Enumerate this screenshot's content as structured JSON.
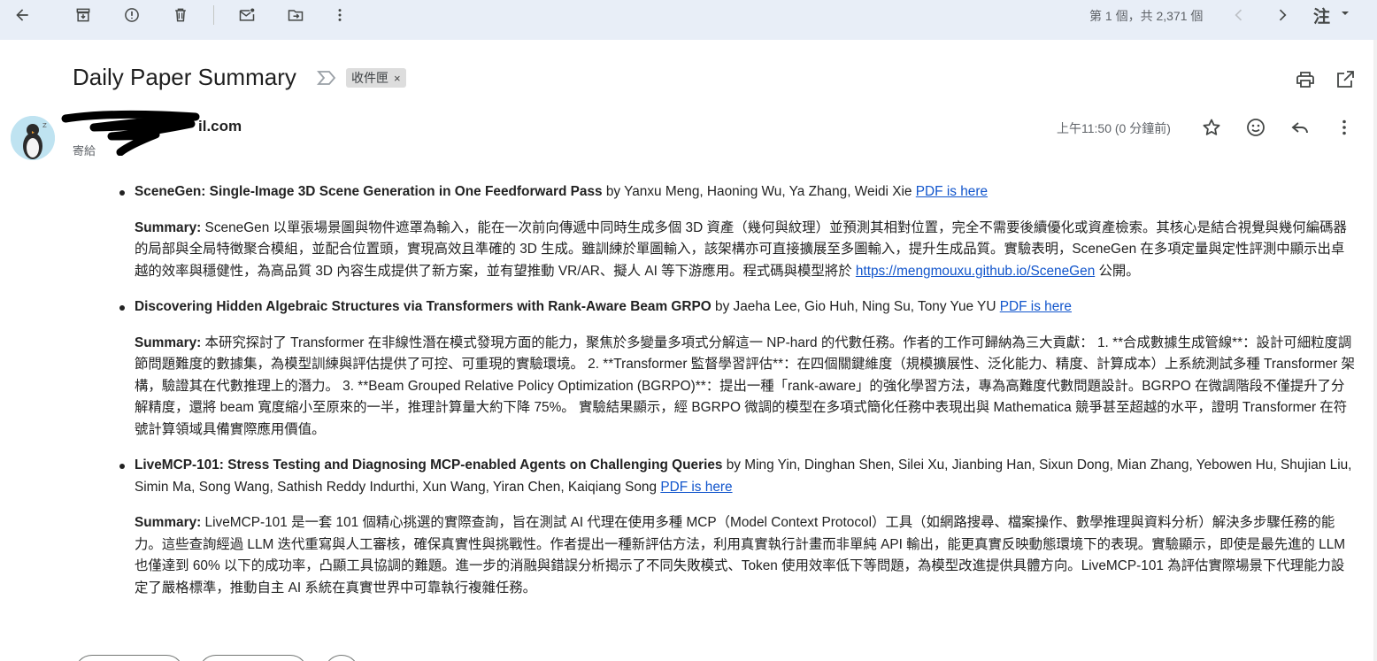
{
  "toolbar": {
    "icons": [
      "back-arrow-icon",
      "archive-icon",
      "report-spam-icon",
      "delete-icon",
      "mark-unread-icon",
      "move-to-icon",
      "more-vert-icon"
    ],
    "pager_text": "第 1 個，共 2,371 個",
    "input_tool_label": "注"
  },
  "message": {
    "subject": "Daily Paper Summary",
    "label": "收件匣",
    "sender_email": "il.com",
    "recipient_prefix": "寄給",
    "time": "上午11:50 (0 分鐘前)"
  },
  "papers": [
    {
      "title": "SceneGen: Single-Image 3D Scene Generation in One Feedforward Pass",
      "authors": " by Yanxu Meng, Haoning Wu, Ya Zhang, Weidi Xie ",
      "pdf_label": "PDF is here",
      "summary_label": "Summary:",
      "summary_text": " SceneGen 以單張場景圖與物件遮罩為輸入，能在一次前向傳遞中同時生成多個 3D 資產（幾何與紋理）並預測其相對位置，完全不需要後續優化或資產檢索。其核心是結合視覺與幾何編碼器的局部與全局特徵聚合模組，並配合位置頭，實現高效且準確的 3D 生成。雖訓練於單圖輸入，該架構亦可直接擴展至多圖輸入，提升生成品質。實驗表明，SceneGen 在多項定量與定性評測中顯示出卓越的效率與穩健性，為高品質 3D 內容生成提供了新方案，並有望推動 VR/AR、擬人 AI 等下游應用。程式碼與模型將於 ",
      "summary_link": "https://mengmouxu.github.io/SceneGen",
      "summary_tail": " 公開。"
    },
    {
      "title": "Discovering Hidden Algebraic Structures via Transformers with Rank-Aware Beam GRPO",
      "authors": " by Jaeha Lee, Gio Huh, Ning Su, Tony Yue YU ",
      "pdf_label": "PDF is here",
      "summary_label": "Summary:",
      "summary_text": " 本研究探討了 Transformer 在非線性潛在模式發現方面的能力，聚焦於多變量多項式分解這一 NP-hard 的代數任務。作者的工作可歸納為三大貢獻： 1. **合成數據生成管線**：設計可細粒度調節問題難度的數據集，為模型訓練與評估提供了可控、可重現的實驗環境。 2. **Transformer 監督學習評估**：在四個關鍵維度（規模擴展性、泛化能力、精度、計算成本）上系統測試多種 Transformer 架構，驗證其在代數推理上的潛力。 3. **Beam Grouped Relative Policy Optimization (BGRPO)**：提出一種「rank-aware」的強化學習方法，專為高難度代數問題設計。BGRPO 在微調階段不僅提升了分解精度，還將 beam 寬度縮小至原來的一半，推理計算量大約下降 75%。 實驗結果顯示，經 BGRPO 微調的模型在多項式簡化任務中表現出與 Mathematica 競爭甚至超越的水平，證明 Transformer 在符號計算領域具備實際應用價值。",
      "summary_link": "",
      "summary_tail": ""
    },
    {
      "title": "LiveMCP-101: Stress Testing and Diagnosing MCP-enabled Agents on Challenging Queries",
      "authors": " by Ming Yin, Dinghan Shen, Silei Xu, Jianbing Han, Sixun Dong, Mian Zhang, Yebowen Hu, Shujian Liu, Simin Ma, Song Wang, Sathish Reddy Indurthi, Xun Wang, Yiran Chen, Kaiqiang Song ",
      "pdf_label": "PDF is here",
      "summary_label": "Summary:",
      "summary_text": " LiveMCP-101 是一套 101 個精心挑選的實際查詢，旨在測試 AI 代理在使用多種 MCP（Model Context Protocol）工具（如網路搜尋、檔案操作、數學推理與資料分析）解決多步驟任務的能力。這些查詢經過 LLM 迭代重寫與人工審核，確保真實性與挑戰性。作者提出一種新評估方法，利用真實執行計畫而非單純 API 輸出，能更真實反映動態環境下的表現。實驗顯示，即使是最先進的 LLM 也僅達到 60% 以下的成功率，凸顯工具協調的難題。進一步的消融與錯誤分析揭示了不同失敗模式、Token 使用效率低下等問題，為模型改進提供具體方向。LiveMCP-101 為評估實際場景下代理能力設定了嚴格標準，推動自主 AI 系統在真實世界中可靠執行複雜任務。",
      "summary_link": "",
      "summary_tail": ""
    }
  ],
  "colors": {
    "toolbar_bg": "#e8eef7",
    "link": "#1155cc",
    "label_chip_bg": "#dddddd"
  }
}
